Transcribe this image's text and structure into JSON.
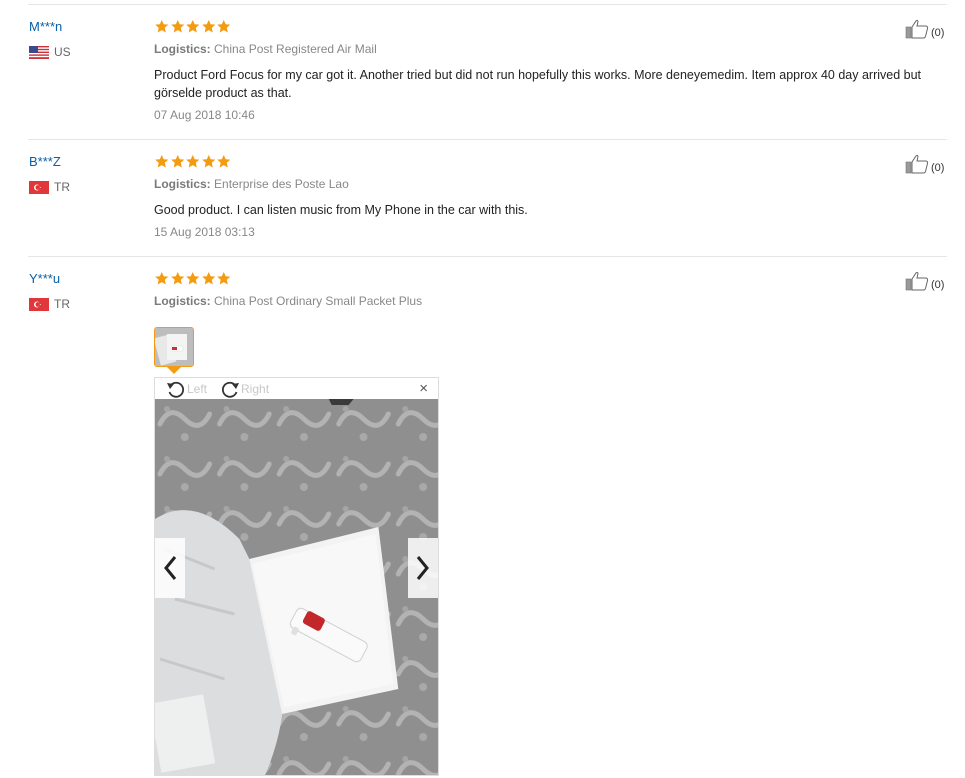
{
  "colors": {
    "star": "#f39c12",
    "username": "#0a5fa8",
    "thumb_border": "#f39c12"
  },
  "reviews": [
    {
      "user": "M***n",
      "country_code": "US",
      "flag_icon": "us-flag-icon",
      "rating": 5,
      "logistics_label": "Logistics:",
      "logistics_value": "China Post Registered Air Mail",
      "text": "Product Ford Focus for my car got it. Another tried but did not run hopefully this works. More deneyemedim. Item approx 40 day arrived but görselde product as that.",
      "date": "07 Aug 2018 10:46",
      "helpful_count": "(0)"
    },
    {
      "user": "B***Z",
      "country_code": "TR",
      "flag_icon": "tr-flag-icon",
      "rating": 5,
      "logistics_label": "Logistics:",
      "logistics_value": "Enterprise des Poste Lao",
      "text": "Good product. I can listen music from My Phone in the car with this.",
      "date": "15 Aug 2018 03:13",
      "helpful_count": "(0)"
    },
    {
      "user": "Y***u",
      "country_code": "TR",
      "flag_icon": "tr-flag-icon",
      "rating": 5,
      "logistics_label": "Logistics:",
      "logistics_value": "China Post Ordinary Small Packet Plus",
      "helpful_count": "(0)"
    }
  ],
  "viewer": {
    "rotate_left_label": "Left",
    "rotate_right_label": "Right",
    "close_symbol": "×"
  }
}
